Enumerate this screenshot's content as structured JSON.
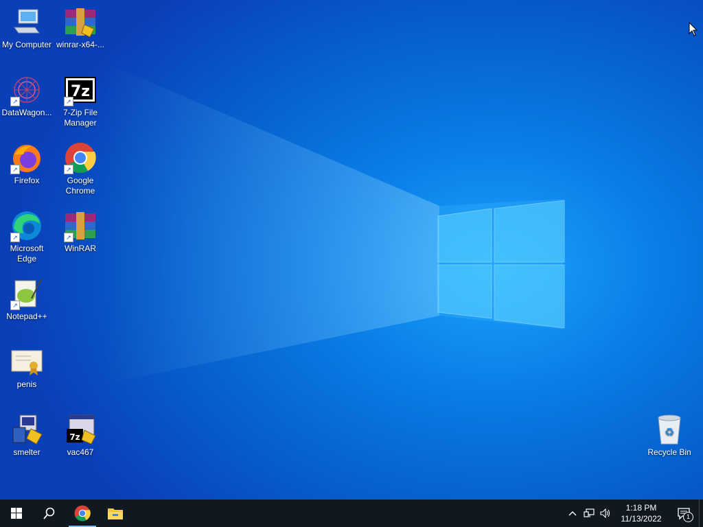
{
  "desktop": {
    "icons": [
      {
        "label": "My Computer",
        "icon": "computer-icon"
      },
      {
        "label": "winrar-x64-...",
        "icon": "winrar-installer-icon"
      },
      {
        "label": "DataWagon...",
        "icon": "datawagon-icon"
      },
      {
        "label": "7-Zip File Manager",
        "icon": "7zip-icon"
      },
      {
        "label": "Firefox",
        "icon": "firefox-icon"
      },
      {
        "label": "Google Chrome",
        "icon": "chrome-icon"
      },
      {
        "label": "Microsoft Edge",
        "icon": "edge-icon"
      },
      {
        "label": "WinRAR",
        "icon": "winrar-icon"
      },
      {
        "label": "Notepad++",
        "icon": "notepadpp-icon"
      },
      {
        "label": "penis",
        "icon": "certificate-icon"
      },
      {
        "label": "smelter",
        "icon": "installer-icon"
      },
      {
        "label": "vac467",
        "icon": "7zip-sfx-icon"
      },
      {
        "label": "Recycle Bin",
        "icon": "recycle-bin-icon"
      }
    ]
  },
  "taskbar": {
    "pinned": [
      "start-icon",
      "search-icon",
      "chrome-icon",
      "file-explorer-icon"
    ],
    "tray_icons": [
      "chevron-up-icon",
      "network-icon",
      "volume-icon"
    ],
    "time": "1:18 PM",
    "date": "11/13/2022",
    "notification_count": "1"
  },
  "colors": {
    "taskbar": "#101820",
    "accent": "#76b9ed",
    "wallpaper": "#0a7de6"
  }
}
